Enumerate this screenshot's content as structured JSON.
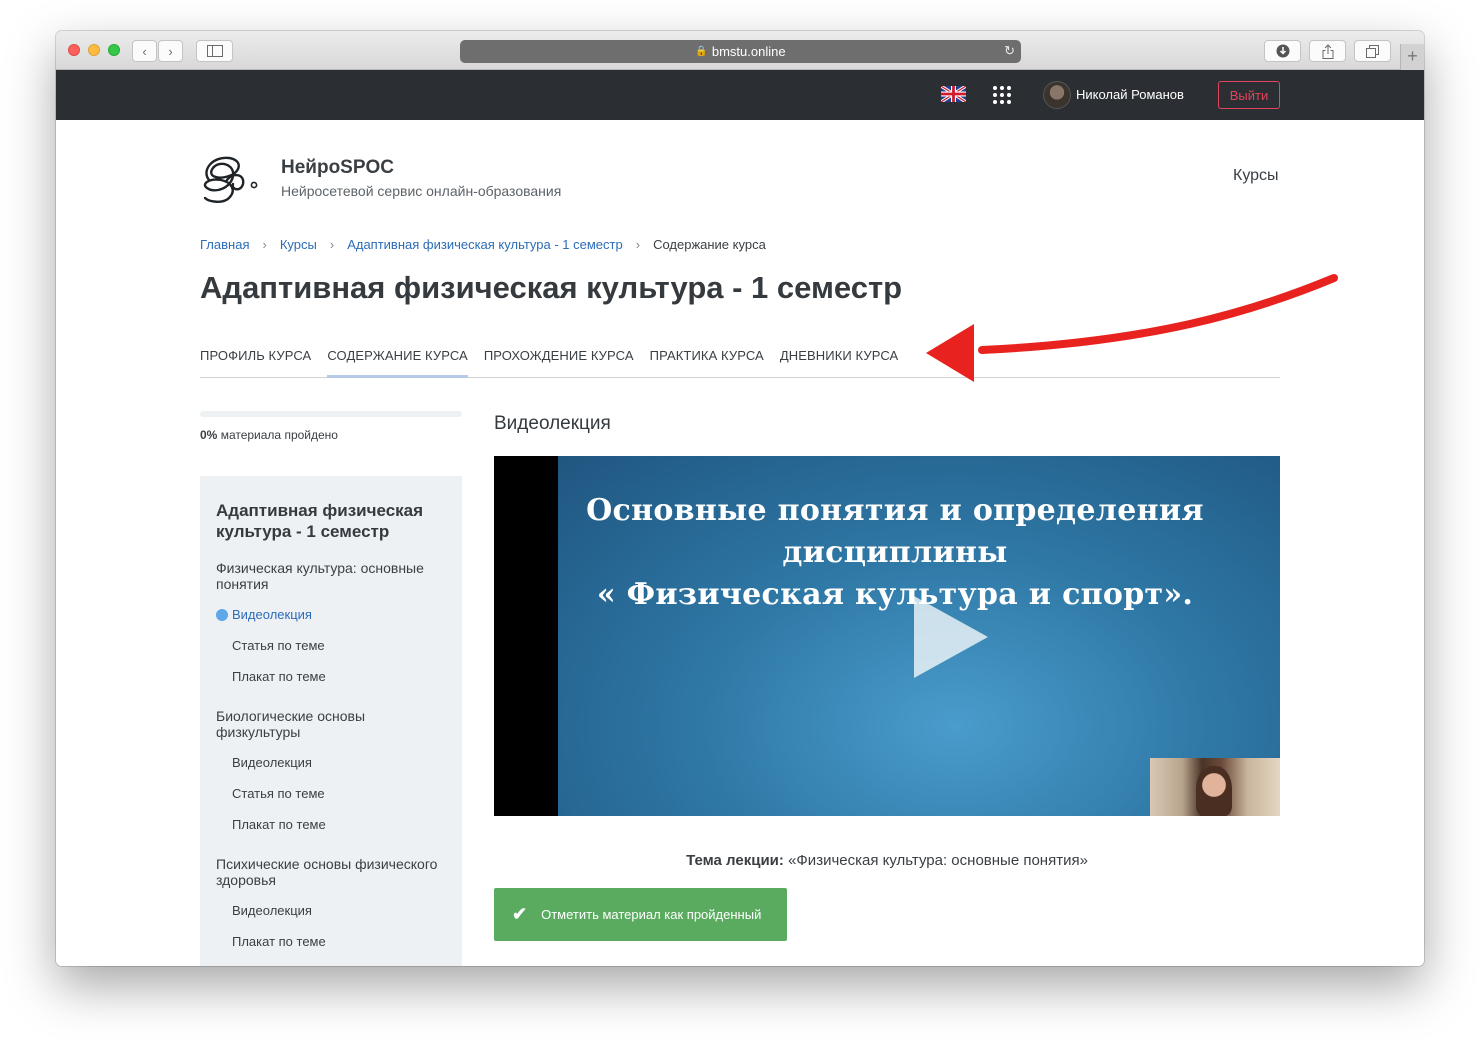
{
  "browser": {
    "url": "bmstu.online",
    "back_icon": "chevron-left-icon",
    "forward_icon": "chevron-right-icon",
    "sidebar_icon": "sidebar-icon",
    "download_icon": "download-icon",
    "share_icon": "share-icon",
    "tabs_icon": "tabs-icon",
    "new_tab_label": "+"
  },
  "topbar": {
    "language_flag": "uk-flag-icon",
    "apps_icon": "apps-grid-icon",
    "user_name": "Николай Романов",
    "logout_label": "Выйти"
  },
  "header": {
    "brand_title": "НейроSPOC",
    "brand_subtitle": "Нейросетевой сервис онлайн-образования",
    "nav_courses": "Курсы"
  },
  "breadcrumb": {
    "items": [
      "Главная",
      "Курсы",
      "Адаптивная физическая культура - 1 семестр"
    ],
    "current": "Содержание курса",
    "separator": "›"
  },
  "page": {
    "title": "Адаптивная физическая культура - 1 семестр"
  },
  "tabs": [
    {
      "label": "ПРОФИЛЬ КУРСА",
      "active": false
    },
    {
      "label": "СОДЕРЖАНИЕ КУРСА",
      "active": true
    },
    {
      "label": "ПРОХОЖДЕНИЕ КУРСА",
      "active": false
    },
    {
      "label": "ПРАКТИКА КУРСА",
      "active": false
    },
    {
      "label": "ДНЕВНИКИ КУРСА",
      "active": false
    }
  ],
  "progress": {
    "percent_label": "0%",
    "text": "материала пройдено",
    "fraction": 0
  },
  "sidebar": {
    "course_title": "Адаптивная физическая культура - 1 семестр",
    "sections": [
      {
        "title": "Физическая культура: основные понятия",
        "items": [
          {
            "label": "Видеолекция",
            "active": true
          },
          {
            "label": "Статья по теме",
            "active": false
          },
          {
            "label": "Плакат по теме",
            "active": false
          }
        ]
      },
      {
        "title": "Биологические основы физкультуры",
        "items": [
          {
            "label": "Видеолекция",
            "active": false
          },
          {
            "label": "Статья по теме",
            "active": false
          },
          {
            "label": "Плакат по теме",
            "active": false
          }
        ]
      },
      {
        "title": "Психические основы физического здоровья",
        "items": [
          {
            "label": "Видеолекция",
            "active": false
          },
          {
            "label": "Плакат по теме",
            "active": false
          }
        ]
      }
    ]
  },
  "main": {
    "title": "Видеолекция",
    "video": {
      "slide_line1": "Основные понятия и определения",
      "slide_line2": "дисциплины",
      "slide_line3": "« Физическая культура и спорт».",
      "play_icon": "play-icon"
    },
    "topic_label": "Тема лекции:",
    "topic_value": "«Физическая культура: основные понятия»",
    "done_button": "Отметить материал как пройденный",
    "done_icon": "checkmark-icon"
  },
  "colors": {
    "topbar_bg": "#2b2f33",
    "link": "#2c6cb8",
    "logout": "#e0455a",
    "done_button": "#5aab60",
    "active_tab_underline": "#b8cbe6",
    "sidebar_bg": "#eef1f4",
    "annotation_arrow": "#e8231f"
  }
}
